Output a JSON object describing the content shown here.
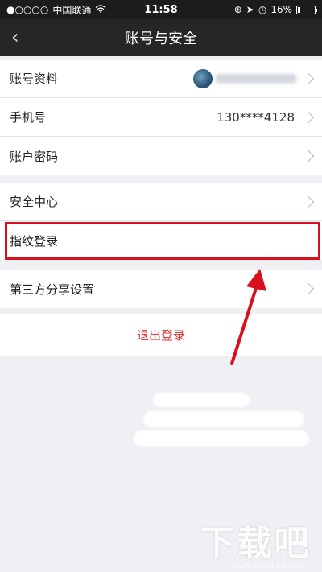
{
  "status_bar": {
    "carrier": "中国联通",
    "time": "11:58",
    "battery_text": "16%",
    "battery_level": 0.16,
    "signal_icon": "signal-dots-icon",
    "wifi_icon": "wifi-icon"
  },
  "nav": {
    "title": "账号与安全",
    "back_icon": "chevron-left-icon"
  },
  "group1": [
    {
      "label": "账号资料"
    },
    {
      "label": "手机号",
      "value": "130****4128"
    },
    {
      "label": "账户密码"
    }
  ],
  "group2": [
    {
      "label": "安全中心"
    },
    {
      "label": "指纹登录"
    }
  ],
  "group3": [
    {
      "label": "第三方分享设置"
    }
  ],
  "logout_label": "退出登录",
  "watermark": {
    "main": "下载吧",
    "sub": "www.xiazaiba.com"
  },
  "colors": {
    "highlight": "#d8101f",
    "logout": "#e23b3b",
    "nav_bg": "#262626"
  }
}
